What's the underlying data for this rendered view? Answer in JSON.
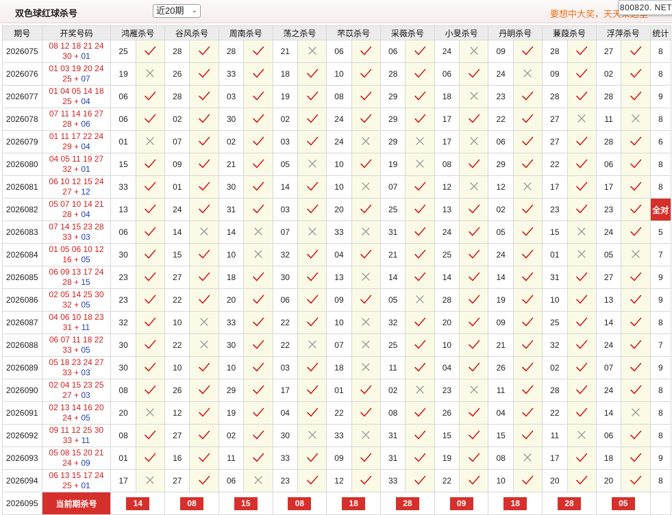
{
  "header": {
    "title": "双色球红球杀号",
    "period_select": "近20期",
    "slogan": "要想中大奖，天天来这里",
    "brand": "800820. NET"
  },
  "columns": [
    "期号",
    "开奖号码",
    "鸿雁杀号",
    "谷风杀号",
    "周南杀号",
    "荡之杀号",
    "芣苡杀号",
    "采薇杀号",
    "小旻杀号",
    "丹眀杀号",
    "蒹葭杀号",
    "浮萍杀号",
    "统计"
  ],
  "rows": [
    {
      "issue": "2026075",
      "reds_top": "08 12 18 21 24",
      "reds_bottom": "30",
      "blue": "01",
      "picks": [
        {
          "n": "25",
          "ok": true
        },
        {
          "n": "28",
          "ok": true
        },
        {
          "n": "28",
          "ok": true
        },
        {
          "n": "21",
          "ok": false
        },
        {
          "n": "06",
          "ok": true
        },
        {
          "n": "06",
          "ok": true
        },
        {
          "n": "24",
          "ok": false
        },
        {
          "n": "09",
          "ok": true
        },
        {
          "n": "28",
          "ok": true
        },
        {
          "n": "27",
          "ok": true
        }
      ],
      "count": "8"
    },
    {
      "issue": "2026076",
      "reds_top": "01 03 19 20 24",
      "reds_bottom": "25",
      "blue": "07",
      "picks": [
        {
          "n": "19",
          "ok": false
        },
        {
          "n": "26",
          "ok": true
        },
        {
          "n": "33",
          "ok": true
        },
        {
          "n": "18",
          "ok": true
        },
        {
          "n": "10",
          "ok": true
        },
        {
          "n": "28",
          "ok": true
        },
        {
          "n": "06",
          "ok": true
        },
        {
          "n": "24",
          "ok": false
        },
        {
          "n": "09",
          "ok": true
        },
        {
          "n": "02",
          "ok": true
        }
      ],
      "count": "8"
    },
    {
      "issue": "2026077",
      "reds_top": "01 04 05 14 18",
      "reds_bottom": "25",
      "blue": "04",
      "picks": [
        {
          "n": "06",
          "ok": true
        },
        {
          "n": "28",
          "ok": true
        },
        {
          "n": "03",
          "ok": true
        },
        {
          "n": "19",
          "ok": true
        },
        {
          "n": "08",
          "ok": true
        },
        {
          "n": "29",
          "ok": true
        },
        {
          "n": "18",
          "ok": false
        },
        {
          "n": "23",
          "ok": true
        },
        {
          "n": "28",
          "ok": true
        },
        {
          "n": "28",
          "ok": true
        }
      ],
      "count": "9"
    },
    {
      "issue": "2026078",
      "reds_top": "07 11 14 16 27",
      "reds_bottom": "28",
      "blue": "06",
      "picks": [
        {
          "n": "06",
          "ok": true
        },
        {
          "n": "02",
          "ok": true
        },
        {
          "n": "30",
          "ok": true
        },
        {
          "n": "02",
          "ok": true
        },
        {
          "n": "24",
          "ok": true
        },
        {
          "n": "29",
          "ok": true
        },
        {
          "n": "17",
          "ok": true
        },
        {
          "n": "22",
          "ok": true
        },
        {
          "n": "27",
          "ok": false
        },
        {
          "n": "11",
          "ok": false
        }
      ],
      "count": "8"
    },
    {
      "issue": "2026079",
      "reds_top": "01 11 17 22 24",
      "reds_bottom": "29",
      "blue": "04",
      "picks": [
        {
          "n": "01",
          "ok": false
        },
        {
          "n": "07",
          "ok": true
        },
        {
          "n": "02",
          "ok": true
        },
        {
          "n": "03",
          "ok": true
        },
        {
          "n": "24",
          "ok": false
        },
        {
          "n": "29",
          "ok": false
        },
        {
          "n": "17",
          "ok": false
        },
        {
          "n": "06",
          "ok": true
        },
        {
          "n": "27",
          "ok": true
        },
        {
          "n": "28",
          "ok": true
        }
      ],
      "count": "6"
    },
    {
      "issue": "2026080",
      "reds_top": "04 05 11 19 27",
      "reds_bottom": "32",
      "blue": "01",
      "picks": [
        {
          "n": "15",
          "ok": true
        },
        {
          "n": "09",
          "ok": true
        },
        {
          "n": "21",
          "ok": true
        },
        {
          "n": "05",
          "ok": false
        },
        {
          "n": "10",
          "ok": true
        },
        {
          "n": "19",
          "ok": false
        },
        {
          "n": "08",
          "ok": true
        },
        {
          "n": "29",
          "ok": true
        },
        {
          "n": "22",
          "ok": true
        },
        {
          "n": "06",
          "ok": true
        }
      ],
      "count": "8"
    },
    {
      "issue": "2026081",
      "reds_top": "06 10 12 15 24",
      "reds_bottom": "27",
      "blue": "12",
      "picks": [
        {
          "n": "33",
          "ok": true
        },
        {
          "n": "01",
          "ok": true
        },
        {
          "n": "30",
          "ok": true
        },
        {
          "n": "14",
          "ok": true
        },
        {
          "n": "10",
          "ok": false
        },
        {
          "n": "07",
          "ok": true
        },
        {
          "n": "12",
          "ok": false
        },
        {
          "n": "12",
          "ok": false
        },
        {
          "n": "17",
          "ok": true
        },
        {
          "n": "17",
          "ok": true
        }
      ],
      "count": "8"
    },
    {
      "issue": "2026082",
      "reds_top": "05 07 10 14 21",
      "reds_bottom": "28",
      "blue": "04",
      "picks": [
        {
          "n": "13",
          "ok": true
        },
        {
          "n": "24",
          "ok": true
        },
        {
          "n": "31",
          "ok": true
        },
        {
          "n": "03",
          "ok": true
        },
        {
          "n": "20",
          "ok": true
        },
        {
          "n": "25",
          "ok": true
        },
        {
          "n": "13",
          "ok": true
        },
        {
          "n": "02",
          "ok": true
        },
        {
          "n": "23",
          "ok": true
        },
        {
          "n": "23",
          "ok": true
        }
      ],
      "count": "全对",
      "full": true
    },
    {
      "issue": "2026083",
      "reds_top": "07 14 15 23 28",
      "reds_bottom": "33",
      "blue": "03",
      "picks": [
        {
          "n": "06",
          "ok": true
        },
        {
          "n": "14",
          "ok": false
        },
        {
          "n": "14",
          "ok": false
        },
        {
          "n": "07",
          "ok": false
        },
        {
          "n": "33",
          "ok": false
        },
        {
          "n": "31",
          "ok": true
        },
        {
          "n": "24",
          "ok": true
        },
        {
          "n": "05",
          "ok": true
        },
        {
          "n": "15",
          "ok": false
        },
        {
          "n": "24",
          "ok": true
        }
      ],
      "count": "5"
    },
    {
      "issue": "2026084",
      "reds_top": "01 05 06 10 12",
      "reds_bottom": "16",
      "blue": "05",
      "picks": [
        {
          "n": "30",
          "ok": true
        },
        {
          "n": "15",
          "ok": true
        },
        {
          "n": "10",
          "ok": false
        },
        {
          "n": "32",
          "ok": true
        },
        {
          "n": "04",
          "ok": true
        },
        {
          "n": "21",
          "ok": true
        },
        {
          "n": "25",
          "ok": true
        },
        {
          "n": "24",
          "ok": true
        },
        {
          "n": "01",
          "ok": false
        },
        {
          "n": "05",
          "ok": false
        }
      ],
      "count": "7"
    },
    {
      "issue": "2026085",
      "reds_top": "06 09 13 17 24",
      "reds_bottom": "28",
      "blue": "15",
      "picks": [
        {
          "n": "23",
          "ok": true
        },
        {
          "n": "27",
          "ok": true
        },
        {
          "n": "18",
          "ok": true
        },
        {
          "n": "30",
          "ok": true
        },
        {
          "n": "13",
          "ok": false
        },
        {
          "n": "14",
          "ok": true
        },
        {
          "n": "14",
          "ok": true
        },
        {
          "n": "14",
          "ok": true
        },
        {
          "n": "31",
          "ok": true
        },
        {
          "n": "27",
          "ok": true
        }
      ],
      "count": "9"
    },
    {
      "issue": "2026086",
      "reds_top": "02 05 14 25 30",
      "reds_bottom": "32",
      "blue": "05",
      "picks": [
        {
          "n": "23",
          "ok": true
        },
        {
          "n": "22",
          "ok": true
        },
        {
          "n": "20",
          "ok": true
        },
        {
          "n": "06",
          "ok": true
        },
        {
          "n": "09",
          "ok": true
        },
        {
          "n": "05",
          "ok": false
        },
        {
          "n": "28",
          "ok": true
        },
        {
          "n": "19",
          "ok": true
        },
        {
          "n": "10",
          "ok": true
        },
        {
          "n": "13",
          "ok": true
        }
      ],
      "count": "9"
    },
    {
      "issue": "2026087",
      "reds_top": "04 06 10 18 23",
      "reds_bottom": "31",
      "blue": "11",
      "picks": [
        {
          "n": "32",
          "ok": true
        },
        {
          "n": "10",
          "ok": false
        },
        {
          "n": "33",
          "ok": true
        },
        {
          "n": "22",
          "ok": true
        },
        {
          "n": "10",
          "ok": false
        },
        {
          "n": "32",
          "ok": true
        },
        {
          "n": "20",
          "ok": true
        },
        {
          "n": "09",
          "ok": true
        },
        {
          "n": "25",
          "ok": true
        },
        {
          "n": "14",
          "ok": true
        }
      ],
      "count": "8"
    },
    {
      "issue": "2026088",
      "reds_top": "06 07 11 18 22",
      "reds_bottom": "33",
      "blue": "05",
      "picks": [
        {
          "n": "30",
          "ok": true
        },
        {
          "n": "22",
          "ok": false
        },
        {
          "n": "30",
          "ok": true
        },
        {
          "n": "22",
          "ok": false
        },
        {
          "n": "07",
          "ok": false
        },
        {
          "n": "25",
          "ok": true
        },
        {
          "n": "10",
          "ok": true
        },
        {
          "n": "21",
          "ok": true
        },
        {
          "n": "32",
          "ok": true
        },
        {
          "n": "24",
          "ok": true
        }
      ],
      "count": "7"
    },
    {
      "issue": "2026089",
      "reds_top": "05 18 23 24 27",
      "reds_bottom": "33",
      "blue": "03",
      "picks": [
        {
          "n": "30",
          "ok": true
        },
        {
          "n": "10",
          "ok": true
        },
        {
          "n": "10",
          "ok": true
        },
        {
          "n": "03",
          "ok": true
        },
        {
          "n": "18",
          "ok": false
        },
        {
          "n": "11",
          "ok": true
        },
        {
          "n": "04",
          "ok": true
        },
        {
          "n": "26",
          "ok": true
        },
        {
          "n": "02",
          "ok": true
        },
        {
          "n": "07",
          "ok": true
        }
      ],
      "count": "9"
    },
    {
      "issue": "2026090",
      "reds_top": "02 04 15 23 25",
      "reds_bottom": "27",
      "blue": "03",
      "picks": [
        {
          "n": "08",
          "ok": true
        },
        {
          "n": "26",
          "ok": true
        },
        {
          "n": "29",
          "ok": true
        },
        {
          "n": "17",
          "ok": true
        },
        {
          "n": "01",
          "ok": true
        },
        {
          "n": "02",
          "ok": false
        },
        {
          "n": "23",
          "ok": false
        },
        {
          "n": "11",
          "ok": true
        },
        {
          "n": "28",
          "ok": true
        },
        {
          "n": "24",
          "ok": true
        }
      ],
      "count": "8"
    },
    {
      "issue": "2026091",
      "reds_top": "02 13 14 16 20",
      "reds_bottom": "24",
      "blue": "05",
      "picks": [
        {
          "n": "20",
          "ok": false
        },
        {
          "n": "12",
          "ok": true
        },
        {
          "n": "19",
          "ok": true
        },
        {
          "n": "04",
          "ok": true
        },
        {
          "n": "22",
          "ok": true
        },
        {
          "n": "08",
          "ok": true
        },
        {
          "n": "26",
          "ok": true
        },
        {
          "n": "04",
          "ok": true
        },
        {
          "n": "22",
          "ok": true
        },
        {
          "n": "14",
          "ok": false
        }
      ],
      "count": "8"
    },
    {
      "issue": "2026092",
      "reds_top": "09 11 12 25 30",
      "reds_bottom": "33",
      "blue": "11",
      "picks": [
        {
          "n": "08",
          "ok": true
        },
        {
          "n": "27",
          "ok": true
        },
        {
          "n": "02",
          "ok": true
        },
        {
          "n": "30",
          "ok": false
        },
        {
          "n": "33",
          "ok": false
        },
        {
          "n": "31",
          "ok": true
        },
        {
          "n": "15",
          "ok": true
        },
        {
          "n": "15",
          "ok": true
        },
        {
          "n": "11",
          "ok": false
        },
        {
          "n": "06",
          "ok": true
        }
      ],
      "count": "8"
    },
    {
      "issue": "2026093",
      "reds_top": "05 08 15 20 21",
      "reds_bottom": "24",
      "blue": "09",
      "picks": [
        {
          "n": "01",
          "ok": true
        },
        {
          "n": "16",
          "ok": true
        },
        {
          "n": "11",
          "ok": true
        },
        {
          "n": "33",
          "ok": true
        },
        {
          "n": "09",
          "ok": true
        },
        {
          "n": "31",
          "ok": true
        },
        {
          "n": "19",
          "ok": true
        },
        {
          "n": "08",
          "ok": false
        },
        {
          "n": "17",
          "ok": true
        },
        {
          "n": "18",
          "ok": true
        }
      ],
      "count": "9"
    },
    {
      "issue": "2026094",
      "reds_top": "06 13 15 17 24",
      "reds_bottom": "25",
      "blue": "01",
      "picks": [
        {
          "n": "17",
          "ok": false
        },
        {
          "n": "27",
          "ok": true
        },
        {
          "n": "06",
          "ok": false
        },
        {
          "n": "23",
          "ok": true
        },
        {
          "n": "12",
          "ok": true
        },
        {
          "n": "33",
          "ok": true
        },
        {
          "n": "22",
          "ok": true
        },
        {
          "n": "10",
          "ok": true
        },
        {
          "n": "20",
          "ok": true
        },
        {
          "n": "20",
          "ok": true
        }
      ],
      "count": "8"
    }
  ],
  "current": {
    "issue": "2026095",
    "label": "当前期杀号",
    "picks": [
      "14",
      "08",
      "15",
      "08",
      "18",
      "28",
      "09",
      "18",
      "28",
      "05"
    ]
  },
  "colors": {
    "accent_red": "#d6302c",
    "draw_red": "#d21e1e",
    "draw_blue": "#1f3fb0",
    "check_red": "#d21e1e",
    "cross_gray": "#9a9a9a",
    "mark_bg": "#fbfae6"
  }
}
